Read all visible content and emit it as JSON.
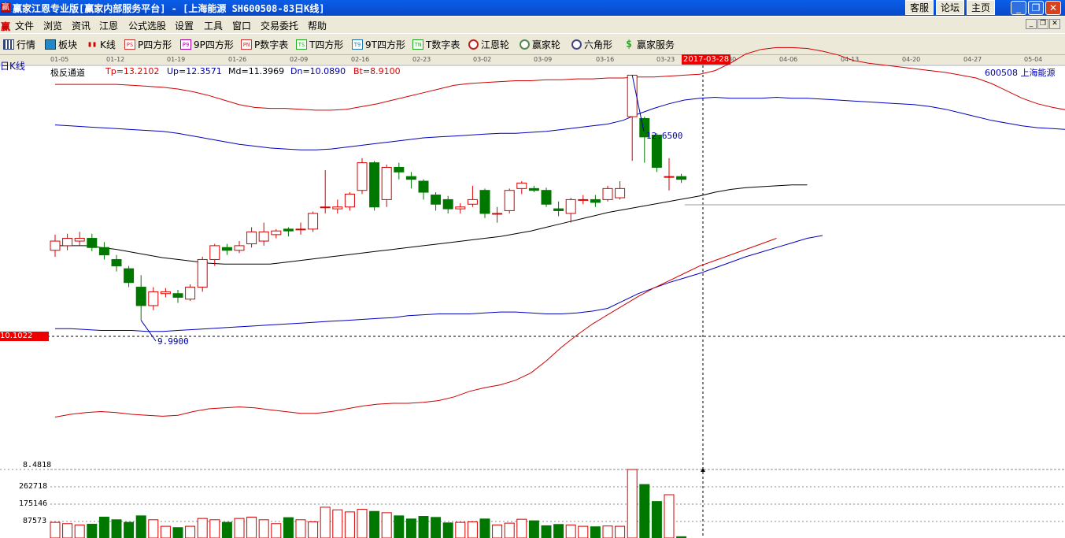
{
  "window": {
    "logo": "赢",
    "title": "赢家江恩专业版[赢家内部服务平台] - [上海能源  SH600508-83日K线]",
    "buttons": [
      "客服",
      "论坛",
      "主页"
    ],
    "controls": [
      "_",
      "❐",
      "✕"
    ]
  },
  "menu": {
    "logo": "赢",
    "items": [
      "文件",
      "浏览",
      "资讯",
      "江恩",
      "公式选股",
      "设置",
      "工具",
      "窗口",
      "交易委托",
      "帮助"
    ]
  },
  "toolbar": {
    "items": [
      {
        "label": "行情",
        "icon": "grid-icon"
      },
      {
        "label": "板块",
        "icon": "blocks-icon"
      },
      {
        "label": "K线",
        "icon": "kline-icon"
      },
      {
        "label": "P四方形",
        "icon": "PS"
      },
      {
        "label": "9P四方形",
        "icon": "P9"
      },
      {
        "label": "P数字表",
        "icon": "PN"
      },
      {
        "label": "T四方形",
        "icon": "TS"
      },
      {
        "label": "9T四方形",
        "icon": "T9"
      },
      {
        "label": "T数字表",
        "icon": "TN"
      },
      {
        "label": "江恩轮",
        "icon": "wheel-icon"
      },
      {
        "label": "赢家轮",
        "icon": "winner-wheel-icon"
      },
      {
        "label": "六角形",
        "icon": "hexagon-icon"
      },
      {
        "label": "赢家服务",
        "icon": "dollar-icon"
      }
    ]
  },
  "date_axis": {
    "labels": [
      "01-05",
      "01-12",
      "01-19",
      "01-26",
      "02-09",
      "02-16",
      "02-23",
      "03-02",
      "03-09",
      "03-16",
      "03-23",
      "03-30",
      "04-06",
      "04-13",
      "04-20",
      "04-27",
      "05-04"
    ],
    "selected": "2017-03-28"
  },
  "chart_header": {
    "period_label": "日K线",
    "indicator": "极反通道",
    "tp": "Tp=13.2102",
    "up": "Up=12.3571",
    "md": "Md=11.3969",
    "dn": "Dn=10.0890",
    "bt": "Bt=8.9100",
    "stock": "600508  上海能源"
  },
  "annotations": {
    "high": "12.6500",
    "low": "9.9900",
    "crosshair_price": "10.1022"
  },
  "volume_axis": {
    "labels": [
      "8.4818",
      "262718",
      "175146",
      "87573"
    ]
  },
  "colors": {
    "up": "#d80000",
    "down": "#007800",
    "band_outer": "#d00000",
    "band_inner": "#0000c0",
    "mid": "#000000"
  },
  "chart_data": {
    "type": "candlestick",
    "series_names": [
      "Tp",
      "Up",
      "Md",
      "Dn",
      "Bt"
    ],
    "candles": [
      {
        "o": 10.75,
        "c": 10.85,
        "h": 10.92,
        "l": 10.68
      },
      {
        "o": 10.8,
        "c": 10.88,
        "h": 10.93,
        "l": 10.75
      },
      {
        "o": 10.85,
        "c": 10.88,
        "h": 10.95,
        "l": 10.8
      },
      {
        "o": 10.88,
        "c": 10.78,
        "h": 10.93,
        "l": 10.74
      },
      {
        "o": 10.78,
        "c": 10.7,
        "h": 10.84,
        "l": 10.65
      },
      {
        "o": 10.65,
        "c": 10.58,
        "h": 10.7,
        "l": 10.52
      },
      {
        "o": 10.55,
        "c": 10.4,
        "h": 10.58,
        "l": 10.35
      },
      {
        "o": 10.35,
        "c": 10.15,
        "h": 10.48,
        "l": 9.99
      },
      {
        "o": 10.15,
        "c": 10.3,
        "h": 10.35,
        "l": 10.1
      },
      {
        "o": 10.28,
        "c": 10.3,
        "h": 10.34,
        "l": 10.24
      },
      {
        "o": 10.28,
        "c": 10.24,
        "h": 10.32,
        "l": 10.18
      },
      {
        "o": 10.22,
        "c": 10.35,
        "h": 10.38,
        "l": 10.2
      },
      {
        "o": 10.35,
        "c": 10.65,
        "h": 10.68,
        "l": 10.3
      },
      {
        "o": 10.65,
        "c": 10.8,
        "h": 10.82,
        "l": 10.58
      },
      {
        "o": 10.78,
        "c": 10.75,
        "h": 10.82,
        "l": 10.7
      },
      {
        "o": 10.75,
        "c": 10.8,
        "h": 10.85,
        "l": 10.72
      },
      {
        "o": 10.82,
        "c": 10.95,
        "h": 11.0,
        "l": 10.78
      },
      {
        "o": 10.85,
        "c": 10.95,
        "h": 11.05,
        "l": 10.8
      },
      {
        "o": 10.92,
        "c": 10.96,
        "h": 10.98,
        "l": 10.88
      },
      {
        "o": 10.98,
        "c": 10.96,
        "h": 11.0,
        "l": 10.9
      },
      {
        "o": 10.98,
        "c": 10.98,
        "h": 11.05,
        "l": 10.92
      },
      {
        "o": 10.98,
        "c": 11.15,
        "h": 11.17,
        "l": 10.95
      },
      {
        "o": 11.22,
        "c": 11.22,
        "h": 11.62,
        "l": 11.15
      },
      {
        "o": 11.2,
        "c": 11.22,
        "h": 11.3,
        "l": 11.15
      },
      {
        "o": 11.22,
        "c": 11.36,
        "h": 11.38,
        "l": 11.18
      },
      {
        "o": 11.4,
        "c": 11.7,
        "h": 11.75,
        "l": 11.36
      },
      {
        "o": 11.7,
        "c": 11.22,
        "h": 11.72,
        "l": 11.18
      },
      {
        "o": 11.3,
        "c": 11.65,
        "h": 11.68,
        "l": 11.22
      },
      {
        "o": 11.65,
        "c": 11.6,
        "h": 11.7,
        "l": 11.52
      },
      {
        "o": 11.55,
        "c": 11.52,
        "h": 11.6,
        "l": 11.42
      },
      {
        "o": 11.5,
        "c": 11.38,
        "h": 11.52,
        "l": 11.3
      },
      {
        "o": 11.35,
        "c": 11.25,
        "h": 11.38,
        "l": 11.18
      },
      {
        "o": 11.3,
        "c": 11.2,
        "h": 11.34,
        "l": 11.15
      },
      {
        "o": 11.2,
        "c": 11.22,
        "h": 11.26,
        "l": 11.15
      },
      {
        "o": 11.25,
        "c": 11.3,
        "h": 11.45,
        "l": 11.22
      },
      {
        "o": 11.4,
        "c": 11.15,
        "h": 11.42,
        "l": 11.1
      },
      {
        "o": 11.15,
        "c": 11.15,
        "h": 11.22,
        "l": 11.05
      },
      {
        "o": 11.18,
        "c": 11.4,
        "h": 11.42,
        "l": 11.15
      },
      {
        "o": 11.42,
        "c": 11.48,
        "h": 11.5,
        "l": 11.36
      },
      {
        "o": 11.42,
        "c": 11.4,
        "h": 11.45,
        "l": 11.38
      },
      {
        "o": 11.4,
        "c": 11.25,
        "h": 11.43,
        "l": 11.22
      },
      {
        "o": 11.2,
        "c": 11.18,
        "h": 11.28,
        "l": 11.12
      },
      {
        "o": 11.15,
        "c": 11.3,
        "h": 11.32,
        "l": 11.05
      },
      {
        "o": 11.3,
        "c": 11.3,
        "h": 11.35,
        "l": 11.25
      },
      {
        "o": 11.3,
        "c": 11.27,
        "h": 11.35,
        "l": 11.22
      },
      {
        "o": 11.3,
        "c": 11.42,
        "h": 11.45,
        "l": 11.28
      },
      {
        "o": 11.32,
        "c": 11.42,
        "h": 11.5,
        "l": 11.3
      },
      {
        "o": 12.2,
        "c": 12.65,
        "h": 12.65,
        "l": 11.72
      },
      {
        "o": 12.18,
        "c": 11.98,
        "h": 12.2,
        "l": 11.7
      },
      {
        "o": 12.0,
        "c": 11.65,
        "h": 12.02,
        "l": 11.6
      },
      {
        "o": 11.55,
        "c": 11.55,
        "h": 11.75,
        "l": 11.4
      },
      {
        "o": 11.55,
        "c": 11.52,
        "h": 11.58,
        "l": 11.48
      }
    ],
    "tp": [
      12.55,
      12.55,
      12.55,
      12.55,
      12.55,
      12.54,
      12.53,
      12.52,
      12.5,
      12.47,
      12.43,
      12.38,
      12.33,
      12.3,
      12.29,
      12.29,
      12.28,
      12.27,
      12.27,
      12.28,
      12.31,
      12.34,
      12.38,
      12.42,
      12.46,
      12.5,
      12.54,
      12.56,
      12.57,
      12.58,
      12.59,
      12.59,
      12.6,
      12.6,
      12.61,
      12.61,
      12.62,
      12.62,
      12.63,
      12.63,
      12.64,
      12.65,
      12.66,
      12.7,
      12.78,
      12.88,
      12.93,
      12.95,
      12.95,
      12.94,
      12.91,
      12.87,
      12.81,
      12.78,
      12.76,
      12.74,
      12.72,
      12.7,
      12.68,
      12.65,
      12.62,
      12.56,
      12.48,
      12.4,
      12.34,
      12.3,
      12.27,
      12.24
    ],
    "up": [
      12.11,
      12.1,
      12.09,
      12.08,
      12.07,
      12.06,
      12.05,
      12.04,
      12.02,
      11.99,
      11.96,
      11.93,
      11.9,
      11.88,
      11.86,
      11.85,
      11.84,
      11.84,
      11.85,
      11.87,
      11.89,
      11.91,
      11.93,
      11.95,
      11.97,
      11.98,
      11.99,
      12.0,
      12.01,
      12.02,
      12.02,
      12.03,
      12.04,
      12.06,
      12.08,
      12.1,
      12.12,
      12.16,
      12.23,
      12.29,
      12.34,
      12.38,
      12.4,
      12.41,
      12.4,
      12.4,
      12.4,
      12.41,
      12.4,
      12.4,
      12.39,
      12.38,
      12.37,
      12.36,
      12.35,
      12.34,
      12.33,
      12.31,
      12.28,
      12.24,
      12.2,
      12.16,
      12.13,
      12.1,
      12.08,
      12.07,
      12.06,
      12.06
    ],
    "md": [
      10.8,
      10.8,
      10.8,
      10.78,
      10.76,
      10.73,
      10.7,
      10.67,
      10.65,
      10.63,
      10.61,
      10.6,
      10.6,
      10.6,
      10.6,
      10.62,
      10.64,
      10.66,
      10.68,
      10.7,
      10.72,
      10.74,
      10.76,
      10.78,
      10.8,
      10.82,
      10.84,
      10.86,
      10.88,
      10.9,
      10.93,
      10.96,
      11.0,
      11.04,
      11.08,
      11.12,
      11.16,
      11.19,
      11.22,
      11.25,
      11.28,
      11.31,
      11.34,
      11.38,
      11.41,
      11.43,
      11.44,
      11.45,
      11.46,
      11.46
    ],
    "dn": [
      9.9,
      9.9,
      9.89,
      9.88,
      9.88,
      9.88,
      9.87,
      9.87,
      9.88,
      9.89,
      9.9,
      9.91,
      9.92,
      9.93,
      9.94,
      9.95,
      9.96,
      9.97,
      9.98,
      9.99,
      10.0,
      10.01,
      10.02,
      10.04,
      10.05,
      10.06,
      10.06,
      10.06,
      10.07,
      10.08,
      10.08,
      10.07,
      10.06,
      10.06,
      10.07,
      10.09,
      10.12,
      10.2,
      10.28,
      10.34,
      10.4,
      10.45,
      10.5,
      10.56,
      10.62,
      10.68,
      10.73,
      10.78,
      10.83,
      10.88,
      10.91
    ],
    "bt": [
      8.94,
      8.97,
      8.99,
      9.0,
      8.99,
      8.97,
      8.96,
      8.95,
      8.96,
      9.0,
      9.03,
      9.04,
      9.05,
      9.04,
      9.02,
      9.0,
      8.98,
      8.98,
      9.0,
      9.03,
      9.06,
      9.08,
      9.09,
      9.09,
      9.1,
      9.12,
      9.16,
      9.22,
      9.26,
      9.29,
      9.34,
      9.42,
      9.55,
      9.7,
      9.83,
      9.95,
      10.05,
      10.15,
      10.25,
      10.34,
      10.42,
      10.5,
      10.58,
      10.64,
      10.7,
      10.76,
      10.82,
      10.88
    ],
    "volume": [
      60000,
      55000,
      50000,
      53000,
      80000,
      70000,
      60000,
      85000,
      70000,
      45000,
      40000,
      45000,
      75000,
      70000,
      60000,
      75000,
      80000,
      70000,
      55000,
      78000,
      70000,
      62000,
      118000,
      108000,
      100000,
      110000,
      102000,
      97000,
      85000,
      73000,
      83000,
      79000,
      58000,
      60000,
      62000,
      73000,
      50000,
      57000,
      72000,
      66000,
      47000,
      52000,
      50000,
      45000,
      43000,
      46000,
      45000,
      262718,
      205000,
      140000,
      166000,
      5000
    ]
  }
}
